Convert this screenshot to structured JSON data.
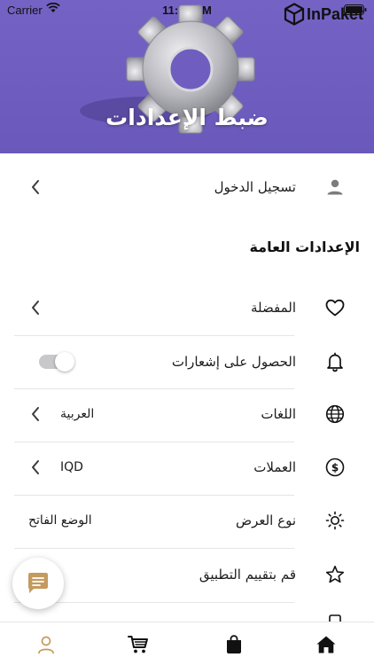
{
  "status_bar": {
    "carrier": "Carrier",
    "time": "11:16 PM"
  },
  "brand": {
    "name": "InPaket"
  },
  "header": {
    "title": "ضبط الإعدادات"
  },
  "login": {
    "label": "تسجيل الدخول"
  },
  "general_section": {
    "title": "الإعدادات العامة"
  },
  "settings": {
    "favorites": {
      "label": "المفضلة"
    },
    "notifications": {
      "label": "الحصول على إشعارات",
      "enabled": true
    },
    "languages": {
      "label": "اللغات",
      "value": "العربية"
    },
    "currencies": {
      "label": "العملات",
      "value": "IQD"
    },
    "display_mode": {
      "label": "نوع العرض",
      "value": "الوضع الفاتح"
    },
    "rate_app": {
      "label": "قم بتقييم التطبيق"
    }
  },
  "colors": {
    "header_bg": "#6f5ec0",
    "text": "#1c1c1e",
    "divider": "#e5e5ea",
    "chat_icon": "#c49a5e"
  },
  "tabbar": {
    "items": [
      {
        "icon": "user-icon",
        "active": true
      },
      {
        "icon": "cart-icon",
        "active": false
      },
      {
        "icon": "bag-icon",
        "active": false
      },
      {
        "icon": "home-icon",
        "active": false
      }
    ]
  }
}
